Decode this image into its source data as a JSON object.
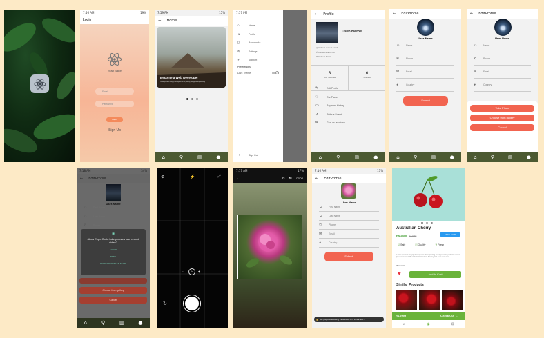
{
  "splash": {
    "logo": "react-atom-icon"
  },
  "login": {
    "status_time": "7:56 AM",
    "status_right": "19%",
    "title": "Login",
    "brand": "React Native",
    "email_placeholder": "Email",
    "password_placeholder": "Password",
    "login_label": "Login",
    "signup_label": "Sign Up"
  },
  "home": {
    "status_time": "7:59 PM",
    "status_right": "15%",
    "title": "Home",
    "card_title": "Become a Web Developer",
    "card_sub": "Lorem ipsum is simply dummy text of the printing and typesetting industry"
  },
  "drawer": {
    "status_time": "7:57 PM",
    "status_right": "16%",
    "items": [
      "Home",
      "Profile",
      "Bookmarks",
      "Settings",
      "Support"
    ],
    "section": "Preferences",
    "dark_theme": "Dark Theme",
    "sign_out": "Sign Out"
  },
  "profile": {
    "title": "Profile",
    "username": "User-Name",
    "email": "Default-current email",
    "phone": "Default-Phone no",
    "email2": "Default-Email",
    "courses_n": "3",
    "courses_label": "Your Courses",
    "wishlist_n": "6",
    "wishlist_label": "Wishlist",
    "menu": [
      "Edit Profile",
      "Our Plans",
      "Payment History",
      "Refer a Friend",
      "Give us feedback"
    ]
  },
  "edit1": {
    "title": "EditProfile",
    "username": "User-Name",
    "fields": [
      "Name",
      "Phone",
      "Email",
      "Country"
    ],
    "submit": "Submit"
  },
  "edit2": {
    "title": "EditProfile",
    "username": "User-Name",
    "fields": [
      "Name",
      "Phone",
      "Email",
      "Country"
    ],
    "take": "Take Photo",
    "gallery": "Choose from gallery",
    "cancel": "Cancel"
  },
  "perm": {
    "status_time": "7:18 AM",
    "status_right": "34%",
    "title": "EditProfile",
    "username": "User-Name",
    "fields": [
      "First Name",
      "Last Name",
      "Phone"
    ],
    "dialog_text": "Allow Expo Go to take pictures and record video?",
    "allow": "ALLOW",
    "deny": "DENY",
    "deny_never": "DENY & DON'T ASK AGAIN",
    "gallery": "Choose from gallery",
    "cancel": "Cancel"
  },
  "camera": {
    "zoom": "1x"
  },
  "cropper": {
    "status_time": "7:17 AM",
    "status_right": "17%",
    "crop": "CROP"
  },
  "edit3": {
    "status_time": "7:16 AM",
    "status_right": "17%",
    "title": "EditProfile",
    "username": "User-Name",
    "fields": [
      "First Name",
      "Last Name",
      "Phone",
      "Email",
      "Country"
    ],
    "submit": "Submit",
    "toast": "Your project is accessing the following APIs from a depr..."
  },
  "product": {
    "name": "Australian Cherry",
    "price": "Rs.2450",
    "old_price": "Rs.2950",
    "badge": "FREE SHIP",
    "features": [
      "Safe",
      "Quality",
      "Fresh"
    ],
    "desc": "Lorem ipsum is simply dummy text of the printing and typesetting industry. Lorem ipsum has been the industry's standard dummy text ever since the...",
    "view_more": "View more",
    "add_to_cart": "Add to Cart",
    "similar": "Similar Products",
    "bottom_price": "Rs.2999",
    "checkout": "Check Out",
    "accent": "#6ab33a"
  }
}
